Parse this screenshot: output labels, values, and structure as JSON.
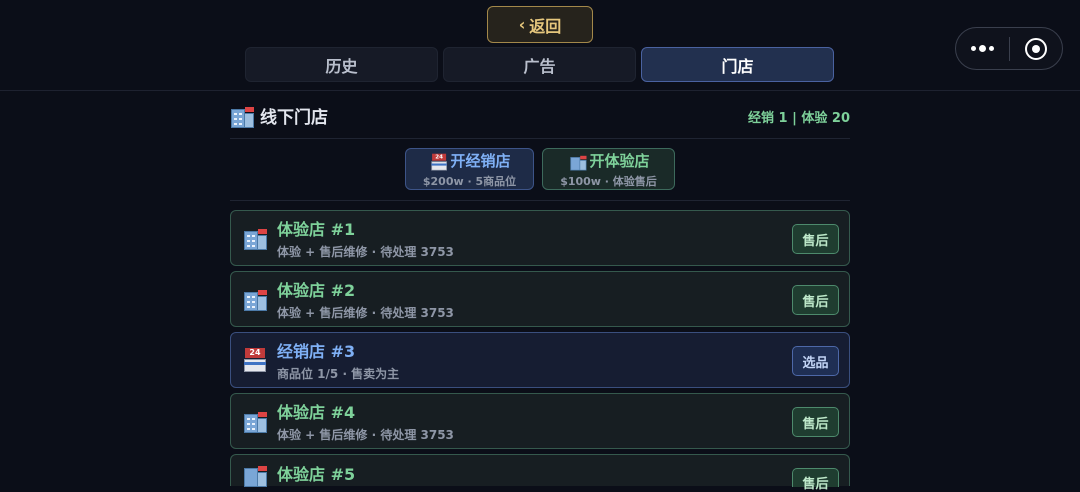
{
  "header": {
    "back_chevron": "‹",
    "back_label": "返回"
  },
  "tabs": [
    {
      "label": "历史",
      "active": false
    },
    {
      "label": "广告",
      "active": false
    },
    {
      "label": "门店",
      "active": true
    }
  ],
  "section": {
    "icon": "store-building-icon",
    "title": "线下门店",
    "stats": "经销 1 | 体验 20"
  },
  "actions": {
    "open_distributor": {
      "icon": "convenience-store-icon",
      "label": "开经销店",
      "sub": "$200w · 5商品位"
    },
    "open_experience": {
      "icon": "store-building-icon",
      "label": "开体验店",
      "sub": "$100w · 体验售后"
    }
  },
  "stores": [
    {
      "type": "exp",
      "icon": "store-building-icon",
      "name": "体验店 #1",
      "desc": "体验 + 售后维修 · 待处理 3753",
      "tag": "售后"
    },
    {
      "type": "exp",
      "icon": "store-building-icon",
      "name": "体验店 #2",
      "desc": "体验 + 售后维修 · 待处理 3753",
      "tag": "售后"
    },
    {
      "type": "dist",
      "icon": "convenience-store-icon",
      "name": "经销店 #3",
      "desc": "商品位 1/5 · 售卖为主",
      "tag": "选品"
    },
    {
      "type": "exp",
      "icon": "store-building-icon",
      "name": "体验店 #4",
      "desc": "体验 + 售后维修 · 待处理 3753",
      "tag": "售后"
    },
    {
      "type": "exp",
      "icon": "store-building-icon",
      "name": "体验店 #5",
      "desc": "",
      "tag": "售后"
    }
  ],
  "colors": {
    "background": "#0b0e18",
    "accent_gold": "#e6c77d",
    "experience_green": "#7ed19a",
    "distributor_blue": "#7fb0f5",
    "active_tab": "#22304f"
  }
}
